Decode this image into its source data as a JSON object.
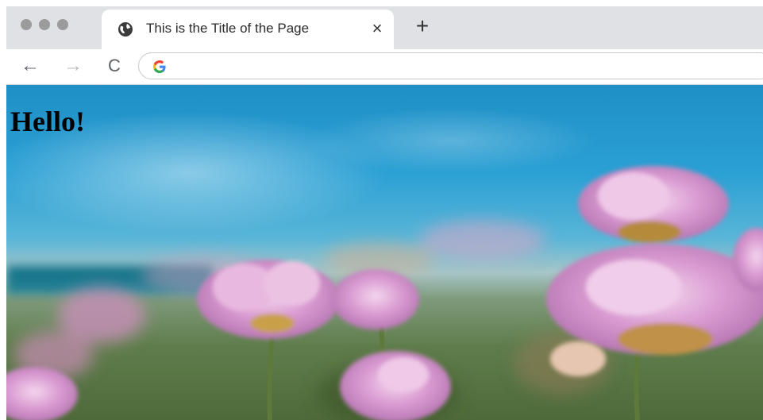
{
  "browser": {
    "tab": {
      "title": "This is the Title of the Page",
      "favicon": "globe-icon",
      "close_glyph": "×"
    },
    "new_tab_glyph": "+",
    "toolbar": {
      "back_glyph": "←",
      "forward_glyph": "→",
      "reload_glyph": "C",
      "address_value": ""
    }
  },
  "page": {
    "heading": "Hello!",
    "background_image": "pink-flowers-field-blue-sky-photo"
  },
  "colors": {
    "tabbar": "#dfe1e5",
    "traffic_light": "#9b9b9b",
    "sky": "#2aa0d4",
    "flower_pink": "#d89ad0"
  }
}
